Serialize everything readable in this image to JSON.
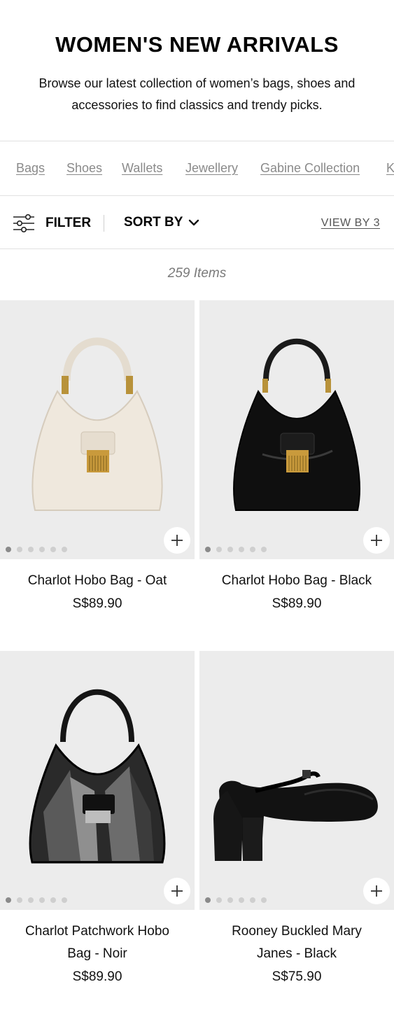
{
  "header": {
    "title": "WOMEN'S NEW ARRIVALS",
    "description": "Browse our latest collection of women’s bags, shoes and accessories to find classics and trendy picks."
  },
  "categories": [
    {
      "label": "Bags"
    },
    {
      "label": "Shoes"
    },
    {
      "label": "Wallets"
    },
    {
      "label": "Jewellery"
    },
    {
      "label": "Gabine Collection"
    },
    {
      "label": "K"
    }
  ],
  "toolbar": {
    "filter_label": "FILTER",
    "sort_label": "SORT BY",
    "view_by_label": "VIEW BY 3"
  },
  "results": {
    "count_text": "259 Items"
  },
  "products": [
    {
      "name": "Charlot Hobo Bag - Oat",
      "price": "S$89.90",
      "image": "hobo-bag-oat",
      "slides": 6,
      "active_slide": 1
    },
    {
      "name": "Charlot Hobo Bag - Black",
      "price": "S$89.90",
      "image": "hobo-bag-black",
      "slides": 6,
      "active_slide": 1
    },
    {
      "name": "Charlot Patchwork Hobo Bag - Noir",
      "price": "S$89.90",
      "image": "hobo-bag-patchwork",
      "slides": 6,
      "active_slide": 1
    },
    {
      "name": "Rooney Buckled Mary Janes - Black",
      "price": "S$75.90",
      "image": "mary-jane-shoe",
      "slides": 6,
      "active_slide": 1
    }
  ],
  "colors": {
    "image_bg": "#ececec",
    "muted_text": "#8a8a8a",
    "rule": "#e1e1e1"
  }
}
